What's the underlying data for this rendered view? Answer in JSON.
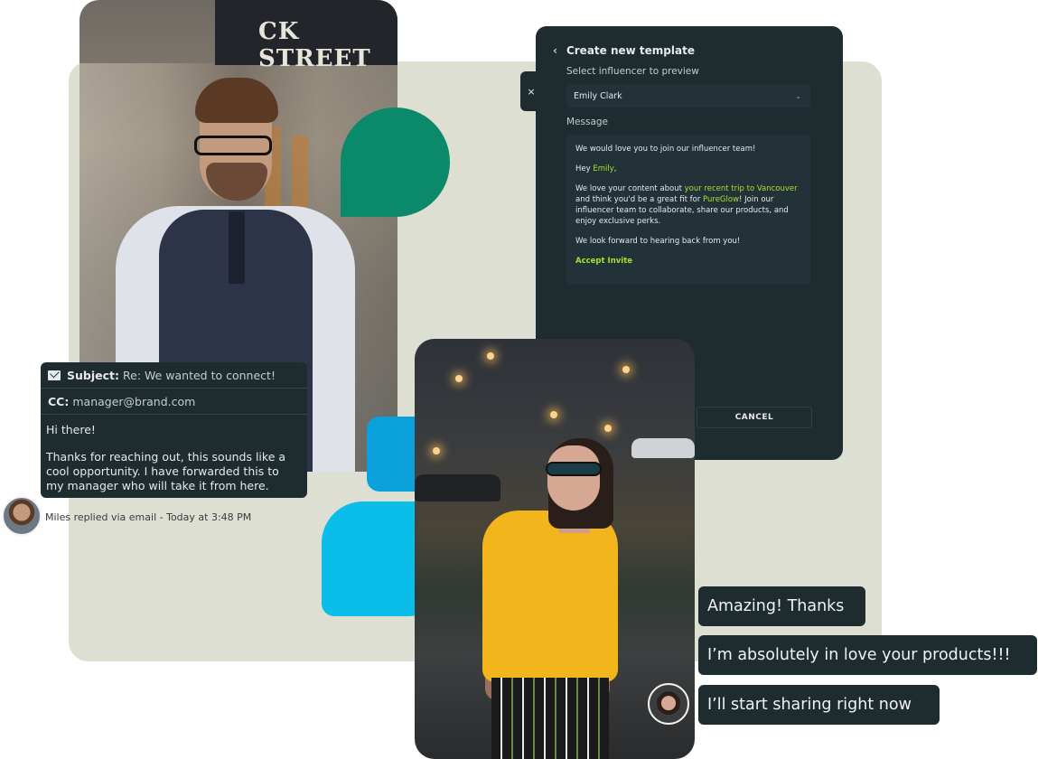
{
  "photo_man": {
    "sign_text": "CK STREET"
  },
  "email": {
    "subject_key": "Subject:",
    "subject_value": "Re: We wanted to connect!",
    "cc_key": "CC:",
    "cc_value": "manager@brand.com",
    "greeting": "Hi there!",
    "body": "Thanks for reaching out, this sounds like a cool opportunity. I have forwarded this to my manager who will take it from here."
  },
  "reply_status": "Miles replied via email - Today at 3:48 PM",
  "template": {
    "title": "Create new template",
    "close_label": "×",
    "select_label": "Select influencer to preview",
    "selected_influencer": "Emily Clark",
    "message_label": "Message",
    "message": {
      "intro": "We would love you to join our influencer team!",
      "hey": "Hey ",
      "name": "Emily",
      "hey_end": ",",
      "p1_a": "We love your content about ",
      "p1_hl": "your recent trip to Vancouver",
      "p1_b": " and think you'd be a great fit for ",
      "p1_brand": "PureGlow",
      "p1_c": "! Join our influencer team to collaborate, share our products, and enjoy exclusive perks.",
      "closing": "We look forward to hearing back from you!",
      "cta": "Accept Invite"
    },
    "cancel_label": "CANCEL"
  },
  "chat": [
    "Amazing! Thanks",
    "I’m absolutely in love your products!!!",
    "I’ll start sharing right now"
  ],
  "colors": {
    "panel_dark": "#1e2b2f",
    "highlight": "#a6e22e",
    "shape_green": "#0b8a6b",
    "shape_blue": "#0aa0db",
    "shape_cyan": "#0bbde9",
    "background_panel": "#dedfd3"
  }
}
